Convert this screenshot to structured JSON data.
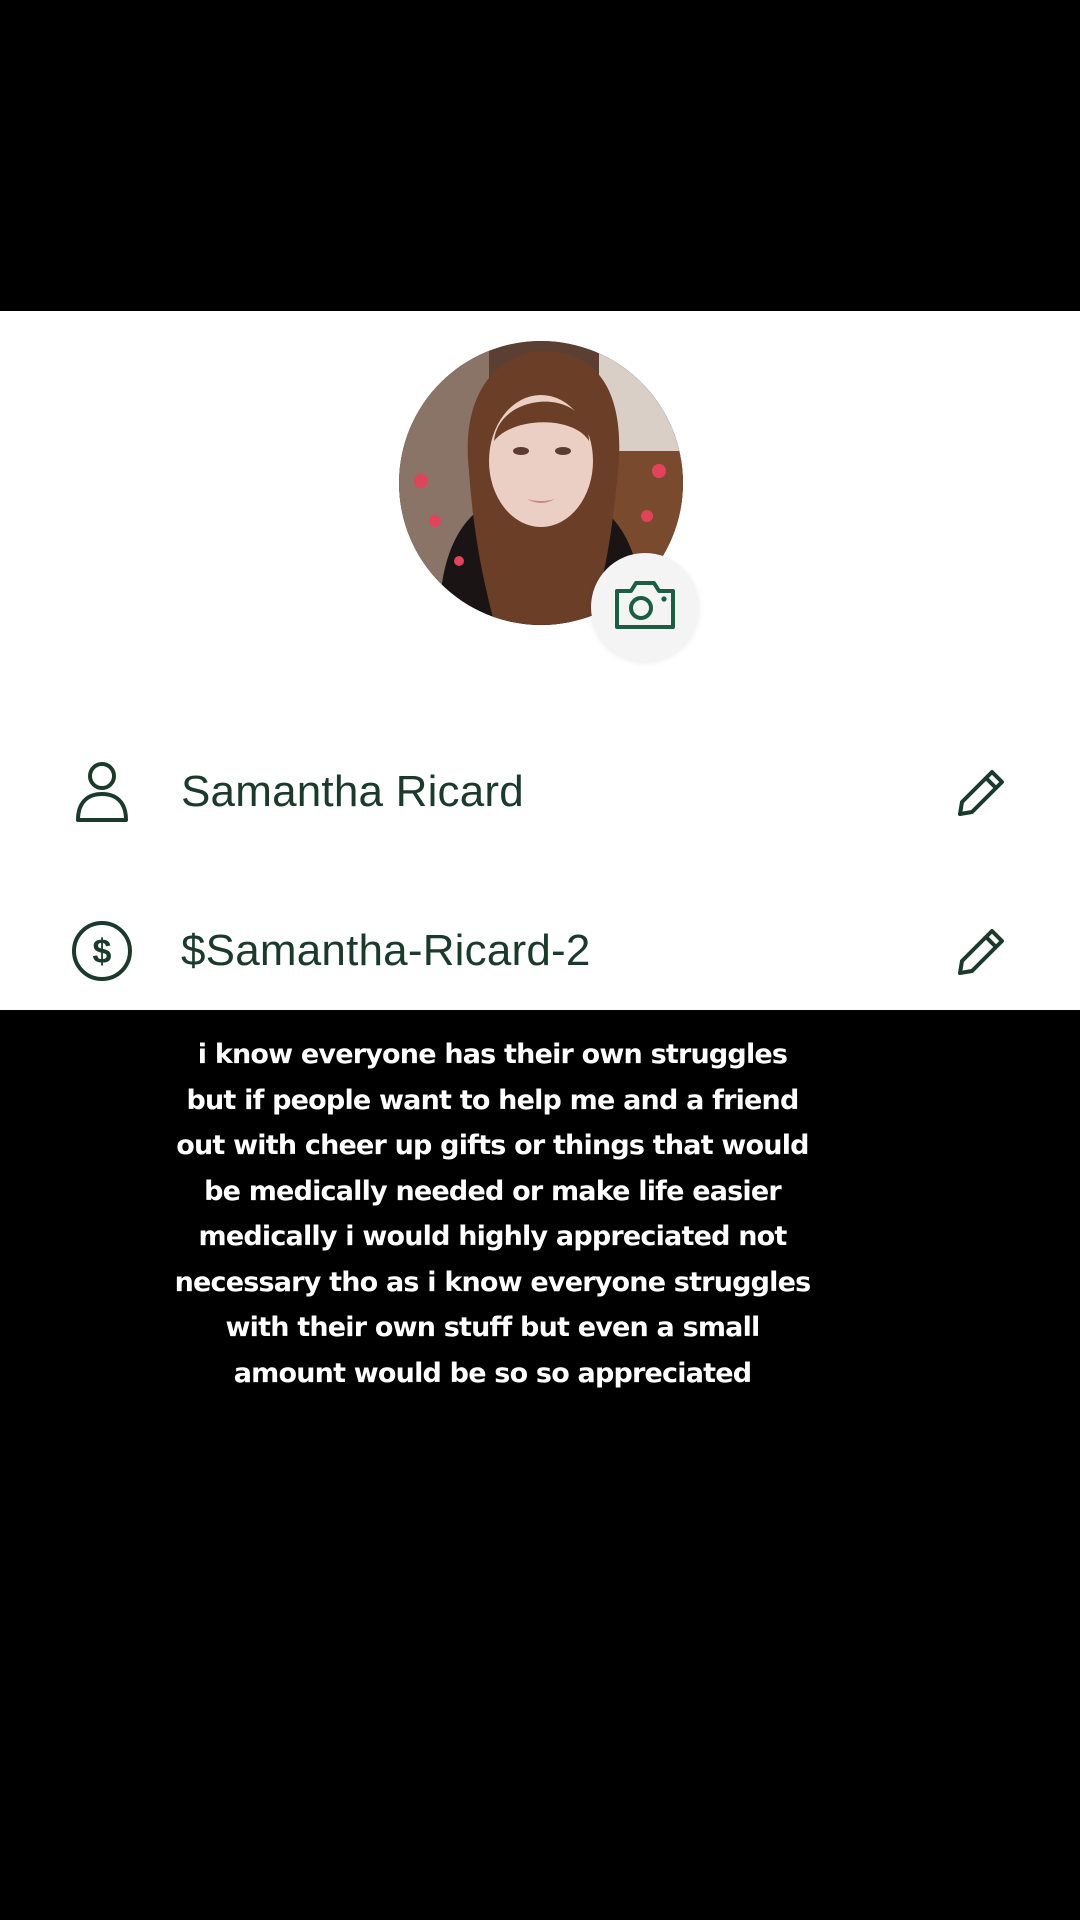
{
  "profile": {
    "avatar_alt": "profile photo",
    "camera_icon": "camera-icon",
    "name": "Samantha Ricard",
    "cashtag": "$Samantha-Ricard-2",
    "person_icon": "person-icon",
    "dollar_icon": "dollar-circle-icon",
    "edit_icon": "pencil-icon",
    "accent_color": "#1b5e43",
    "text_color": "#1b3a2d"
  },
  "caption": {
    "lines": [
      "i know everyone has their own struggles",
      "but if people want to help me and a friend",
      "out with cheer up gifts or things that would",
      "be medically needed or make life easier",
      "medically i would highly appreciated not",
      "necessary tho as i know everyone struggles",
      "with their own stuff but even a small",
      "amount would be so so appreciated"
    ]
  }
}
